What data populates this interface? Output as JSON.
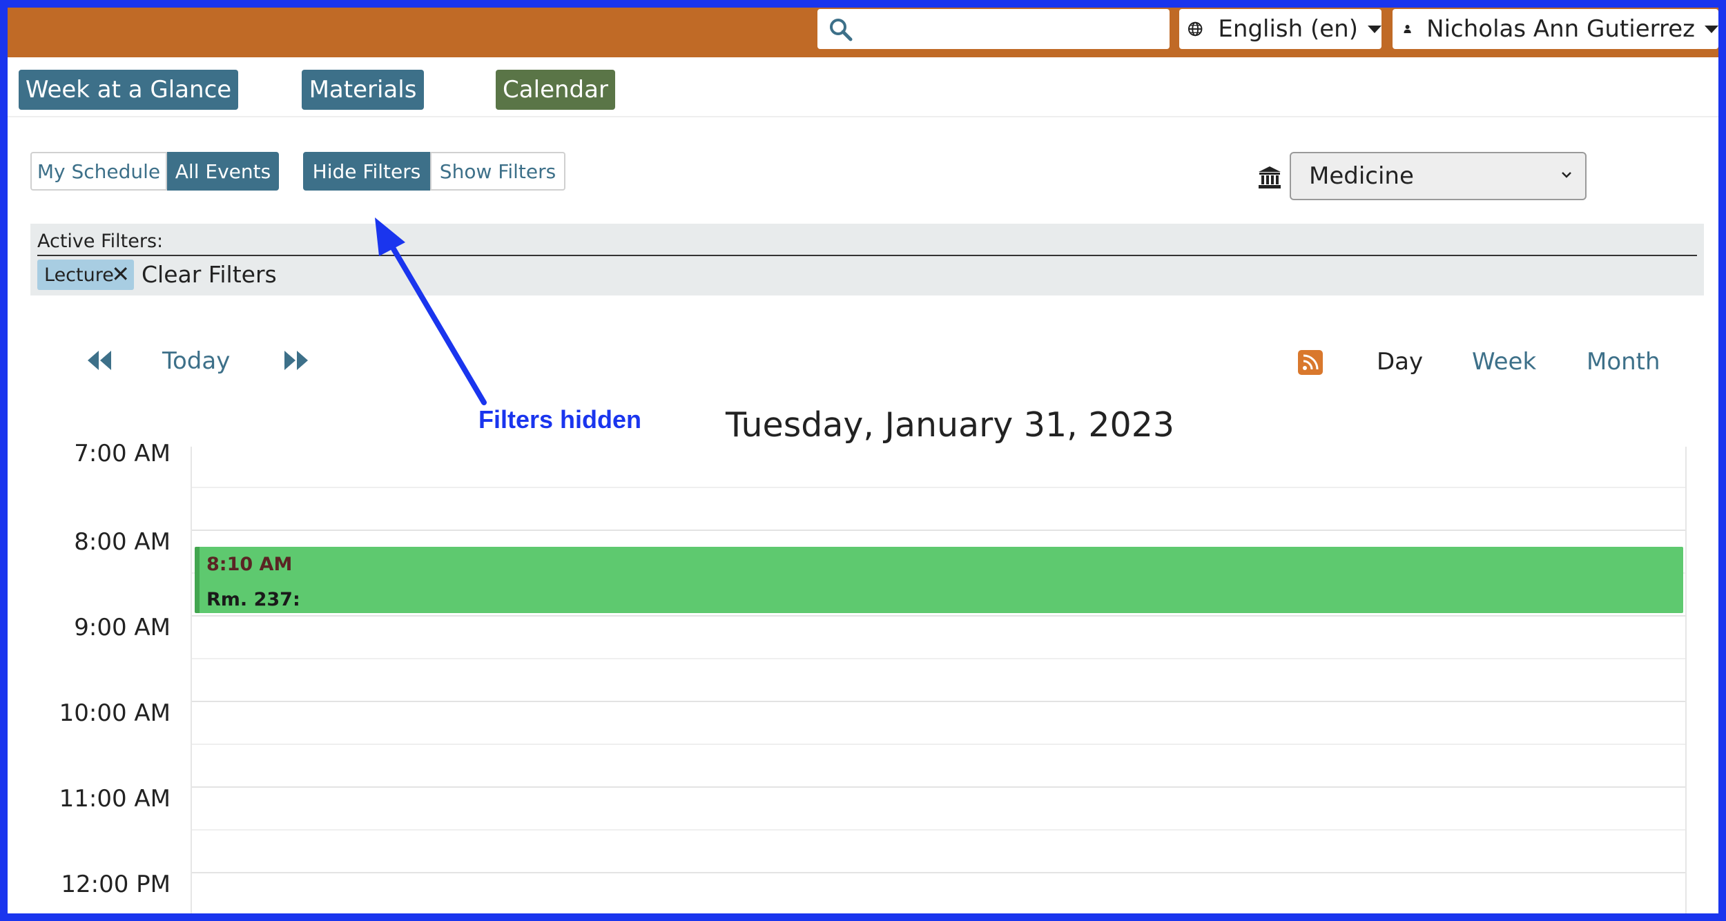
{
  "header": {
    "search": {
      "value": "",
      "placeholder": ""
    },
    "language": {
      "label": "English (en)"
    },
    "user": {
      "name": "Nicholas Ann Gutierrez"
    }
  },
  "nav": {
    "week_at_a_glance": "Week at a Glance",
    "materials": "Materials",
    "calendar": "Calendar"
  },
  "toggles": {
    "schedule": {
      "my_schedule": "My Schedule",
      "all_events": "All Events",
      "active": "All Events"
    },
    "filters": {
      "hide": "Hide Filters",
      "show": "Show Filters",
      "active": "Hide Filters"
    }
  },
  "institution": {
    "selected": "Medicine"
  },
  "active_filters": {
    "title": "Active Filters:",
    "chips": [
      {
        "label": "Lecture"
      }
    ],
    "clear_label": "Clear Filters"
  },
  "calendar": {
    "today_label": "Today",
    "views": {
      "day": "Day",
      "week": "Week",
      "month": "Month",
      "active": "Day"
    },
    "title": "Tuesday, January 31, 2023",
    "hours": [
      "7:00 AM",
      "8:00 AM",
      "9:00 AM",
      "10:00 AM",
      "11:00 AM",
      "12:00 PM"
    ],
    "events": [
      {
        "time": "8:10 AM",
        "location": "Rm. 237:",
        "color": "#5ec96f"
      }
    ]
  },
  "annotation": {
    "text": "Filters hidden",
    "color": "#1a35ee"
  },
  "colors": {
    "topbar": "#c06a26",
    "primary": "#3d7089",
    "calendar_tab": "#5a7547",
    "frame": "#1a35ee"
  },
  "icons": {
    "search": "search-icon",
    "language": "globe-icon",
    "user": "user-icon",
    "institution": "institution-icon",
    "prev": "rewind-icon",
    "next": "fast-forward-icon",
    "rss": "rss-icon"
  }
}
